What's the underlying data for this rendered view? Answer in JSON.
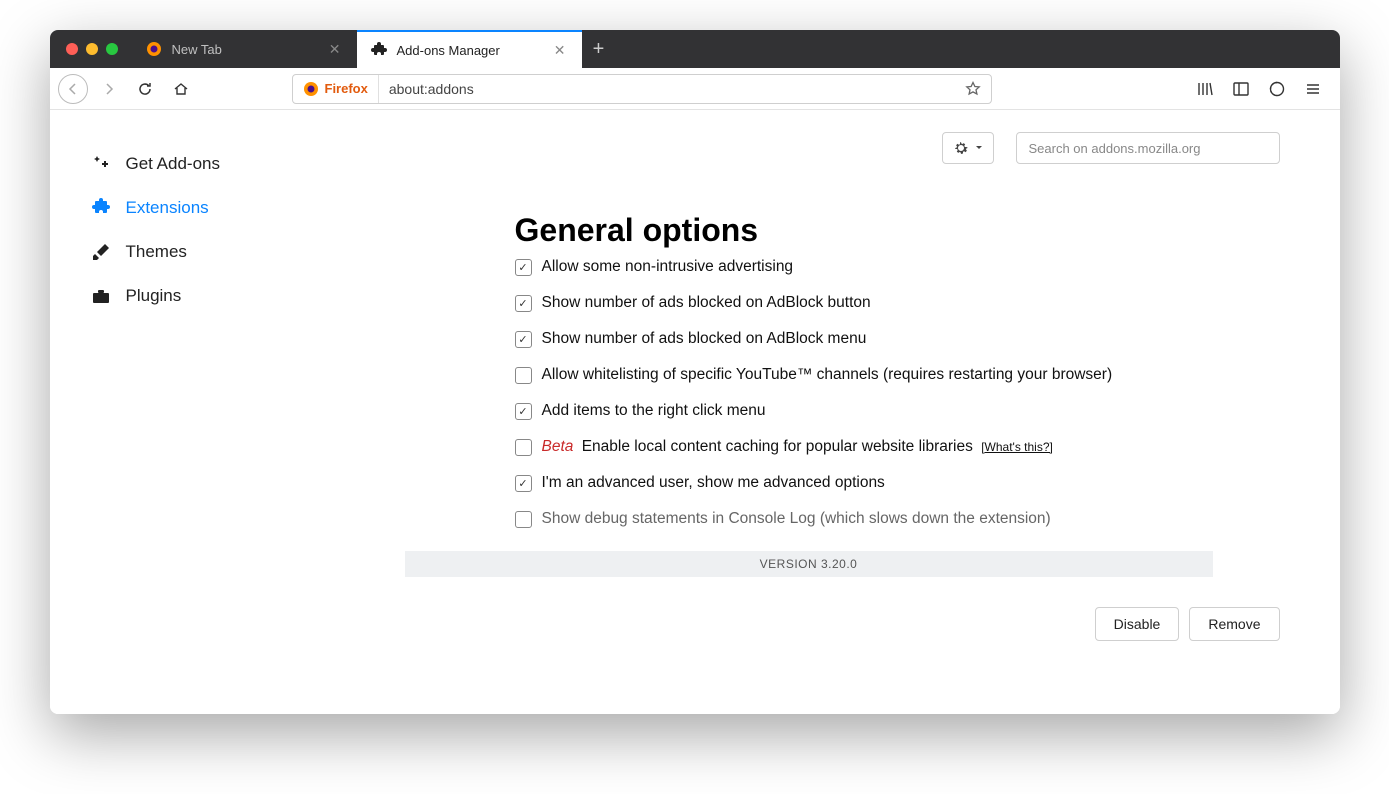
{
  "tabs": {
    "inactive": "New Tab",
    "active": "Add-ons Manager"
  },
  "urlbar": {
    "brand": "Firefox",
    "url": "about:addons"
  },
  "sidebar": {
    "items": [
      "Get Add-ons",
      "Extensions",
      "Themes",
      "Plugins"
    ]
  },
  "searchPlaceholder": "Search on addons.mozilla.org",
  "panel": {
    "title": "General options",
    "options": {
      "o1": "Allow some non-intrusive advertising",
      "o2": "Show number of ads blocked on AdBlock button",
      "o3": "Show number of ads blocked on AdBlock menu",
      "o4": "Allow whitelisting of specific YouTube™ channels (requires restarting your browser)",
      "o5": "Add items to the right click menu",
      "o6beta": "Beta",
      "o6": "Enable local content caching for popular website libraries",
      "o6link": "[What's this?]",
      "o7": "I'm an advanced user, show me advanced options",
      "o8": "Show debug statements in Console Log (which slows down the extension)"
    },
    "version": "VERSION 3.20.0"
  },
  "actions": {
    "disable": "Disable",
    "remove": "Remove"
  }
}
